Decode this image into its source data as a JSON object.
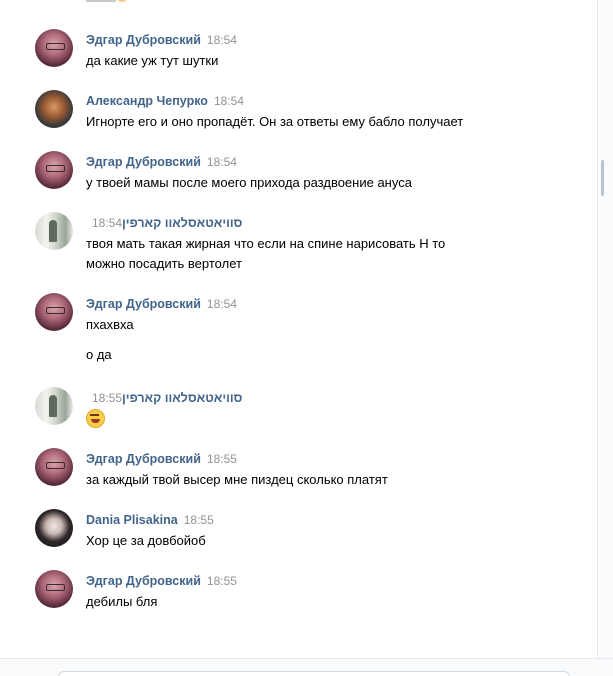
{
  "messages": [
    {
      "author": "Эдгар Дубровский",
      "time": "18:54",
      "avatar": "avatar-edgar",
      "lines": [
        "да какие уж тут шутки"
      ]
    },
    {
      "author": "Александр Чепурко",
      "time": "18:54",
      "avatar": "avatar-alex",
      "lines": [
        "Игнорте его и оно пропадёт. Он за ответы ему бабло получает"
      ]
    },
    {
      "author": "Эдгар Дубровский",
      "time": "18:54",
      "avatar": "avatar-edgar",
      "lines": [
        "у твоей мамы после моего прихода раздвоение ануса"
      ]
    },
    {
      "author": "סוויאטאסלאוו קארפין",
      "time": "18:54",
      "avatar": "avatar-hebrew",
      "lines": [
        "твоя мать такая жирная что если на спине нарисовать Н то",
        "можно посадить вертолет"
      ]
    },
    {
      "author": "Эдгар Дубровский",
      "time": "18:54",
      "avatar": "avatar-edgar",
      "lines": [
        "пхахвха"
      ],
      "extra": "о да"
    },
    {
      "author": "סוויאטאסלאוו קארפין",
      "time": "18:55",
      "avatar": "avatar-hebrew",
      "emoji": "laughing-emoji"
    },
    {
      "author": "Эдгар Дубровский",
      "time": "18:55",
      "avatar": "avatar-edgar",
      "lines": [
        "за каждый твой высер мне пиздец сколько платят"
      ]
    },
    {
      "author": "Dania Plisakina",
      "time": "18:55",
      "avatar": "avatar-dania",
      "lines": [
        "Хор це за довбойоб"
      ]
    },
    {
      "author": "Эдгар Дубровский",
      "time": "18:55",
      "avatar": "avatar-edgar",
      "lines": [
        "дебилы бля"
      ]
    }
  ],
  "colors": {
    "author": "#42648b",
    "time": "#939393",
    "text": "#000000"
  }
}
